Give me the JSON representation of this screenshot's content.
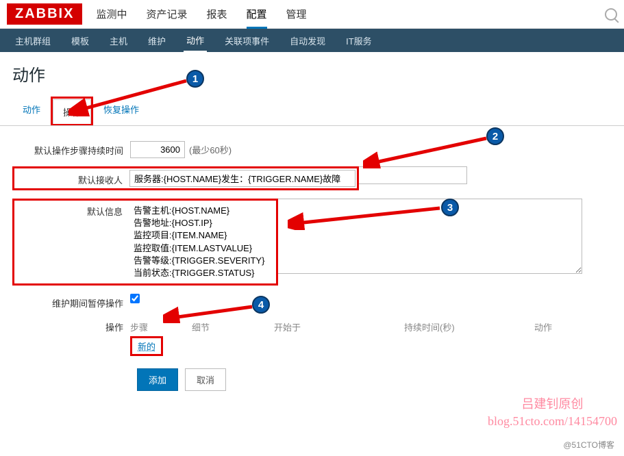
{
  "logo": "ZABBIX",
  "topmenu": [
    "监测中",
    "资产记录",
    "报表",
    "配置",
    "管理"
  ],
  "topmenu_active": 3,
  "submenu": [
    "主机群组",
    "模板",
    "主机",
    "维护",
    "动作",
    "关联项事件",
    "自动发现",
    "IT服务"
  ],
  "submenu_active": 4,
  "page_title": "动作",
  "tabs": [
    "动作",
    "操作",
    "恢复操作"
  ],
  "tabs_active": 1,
  "form": {
    "duration_label": "默认操作步骤持续时间",
    "duration_value": "3600",
    "duration_hint": "(最少60秒)",
    "subject_label": "默认接收人",
    "subject_value": "服务器:{HOST.NAME}发生：{TRIGGER.NAME}故障",
    "message_label": "默认信息",
    "message_value": "告警主机:{HOST.NAME}\n告警地址:{HOST.IP}\n监控项目:{ITEM.NAME}\n监控取值:{ITEM.LASTVALUE}\n告警等级:{TRIGGER.SEVERITY}\n当前状态:{TRIGGER.STATUS}",
    "pause_label": "维护期间暂停操作",
    "pause_checked": true,
    "ops_label": "操作",
    "ops_headers": [
      "步骤",
      "细节",
      "开始于",
      "持续时间(秒)",
      "动作"
    ],
    "new_link": "新的"
  },
  "buttons": {
    "add": "添加",
    "cancel": "取消"
  },
  "badges": {
    "b1": "1",
    "b2": "2",
    "b3": "3",
    "b4": "4"
  },
  "watermark": {
    "line1": "吕建钊原创",
    "line2": "blog.51cto.com/14154700"
  },
  "credit": "@51CTO博客"
}
